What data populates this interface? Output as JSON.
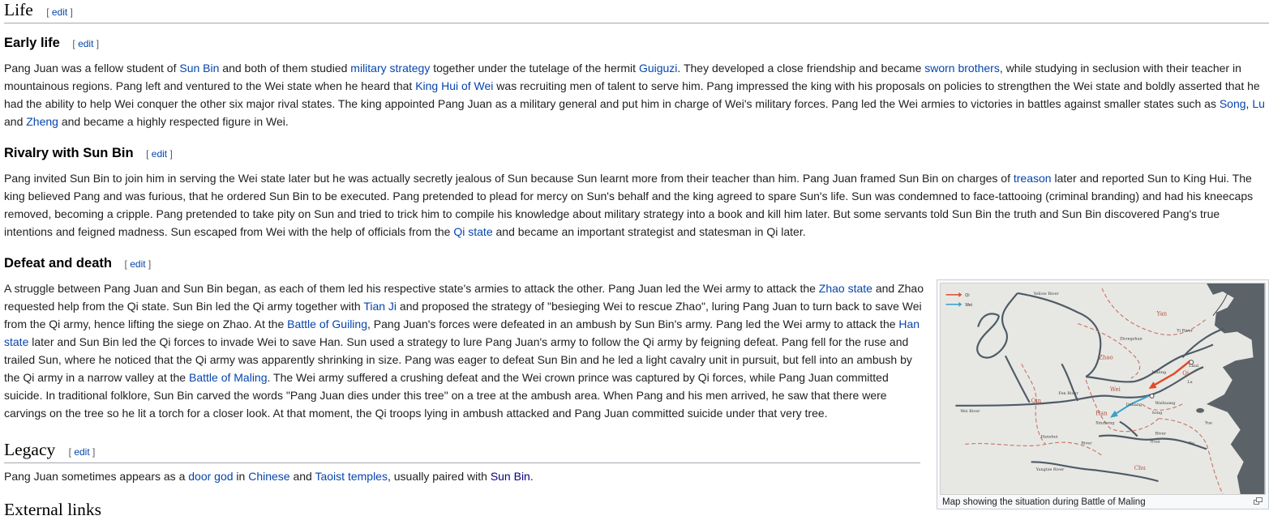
{
  "edit_label": "edit",
  "sections": {
    "life": {
      "title": "Life"
    },
    "early": {
      "title": "Early life",
      "text": [
        "Pang Juan was a fellow student of ",
        {
          "link": "Sun Bin"
        },
        " and both of them studied ",
        {
          "link": "military strategy"
        },
        " together under the tutelage of the hermit ",
        {
          "link": "Guiguzi"
        },
        ". They developed a close friendship and became ",
        {
          "link": "sworn brothers"
        },
        ", while studying in seclusion with their teacher in mountainous regions. Pang left and ventured to the Wei state when he heard that ",
        {
          "link": "King Hui of Wei"
        },
        " was recruiting men of talent to serve him. Pang impressed the king with his proposals on policies to strengthen the Wei state and boldly asserted that he had the ability to help Wei conquer the other six major rival states. The king appointed Pang Juan as a military general and put him in charge of Wei's military forces. Pang led the Wei armies to victories in battles against smaller states such as ",
        {
          "link": "Song"
        },
        ", ",
        {
          "link": "Lu"
        },
        " and ",
        {
          "link": "Zheng"
        },
        " and became a highly respected figure in Wei."
      ]
    },
    "rivalry": {
      "title": "Rivalry with Sun Bin",
      "text": [
        "Pang invited Sun Bin to join him in serving the Wei state later but he was actually secretly jealous of Sun because Sun learnt more from their teacher than him. Pang Juan framed Sun Bin on charges of ",
        {
          "link": "treason"
        },
        " later and reported Sun to King Hui. The king believed Pang and was furious, that he ordered Sun Bin to be executed. Pang pretended to plead for mercy on Sun's behalf and the king agreed to spare Sun's life. Sun was condemned to face-tattooing (criminal branding) and had his kneecaps removed, becoming a cripple. Pang pretended to take pity on Sun and tried to trick him to compile his knowledge about military strategy into a book and kill him later. But some servants told Sun Bin the truth and Sun Bin discovered Pang's true intentions and feigned madness. Sun escaped from Wei with the help of officials from the ",
        {
          "link": "Qi state"
        },
        " and became an important strategist and statesman in Qi later."
      ]
    },
    "defeat": {
      "title": "Defeat and death",
      "text": [
        "A struggle between Pang Juan and Sun Bin began, as each of them led his respective state's armies to attack the other. Pang Juan led the Wei army to attack the ",
        {
          "link": "Zhao state"
        },
        " and Zhao requested help from the Qi state. Sun Bin led the Qi army together with ",
        {
          "link": "Tian Ji"
        },
        " and proposed the strategy of \"besieging Wei to rescue Zhao\", luring Pang Juan to turn back to save Wei from the Qi army, hence lifting the siege on Zhao. At the ",
        {
          "link": "Battle of Guiling"
        },
        ", Pang Juan's forces were defeated in an ambush by Sun Bin's army. Pang led the Wei army to attack the ",
        {
          "link": "Han state"
        },
        " later and Sun Bin led the Qi forces to invade Wei to save Han. Sun used a strategy to lure Pang Juan's army to follow the Qi army by feigning defeat. Pang fell for the ruse and trailed Sun, where he noticed that the Qi army was apparently shrinking in size. Pang was eager to defeat Sun Bin and he led a light cavalry unit in pursuit, but fell into an ambush by the Qi army in a narrow valley at the ",
        {
          "link": "Battle of Maling"
        },
        ". The Wei army suffered a crushing defeat and the Wei crown prince was captured by Qi forces, while Pang Juan committed suicide. In traditional folklore, Sun Bin carved the words \"Pang Juan dies under this tree\" on a tree at the ambush area. When Pang and his men arrived, he saw that there were carvings on the tree so he lit a torch for a closer look. At that moment, the Qi troops lying in ambush attacked and Pang Juan committed suicide under that very tree."
      ]
    },
    "legacy": {
      "title": "Legacy",
      "text": [
        "Pang Juan sometimes appears as a ",
        {
          "link": "door god"
        },
        " in ",
        {
          "link": "Chinese"
        },
        " and ",
        {
          "link": "Taoist temples"
        },
        ", usually paired with ",
        {
          "link": "Sun Bin",
          "visited": true
        },
        "."
      ]
    },
    "external": {
      "title": "External links"
    }
  },
  "figure": {
    "caption": "Map showing the situation during Battle of Maling",
    "legend": [
      "Qi",
      "Wei"
    ],
    "labels": [
      "Yellow River",
      "Yan",
      "Yi River",
      "Zhongshan",
      "Zhao",
      "Linzi",
      "Qi",
      "Maling",
      "Lu",
      "Wei",
      "Fen River",
      "Qin",
      "Wei River",
      "Daliang",
      "Waihuang",
      "Song",
      "Han",
      "Xinzheng",
      "Ru",
      "Huai",
      "River",
      "Yue",
      "Hanshui",
      "River",
      "Yangtze River",
      "Chu"
    ],
    "colors": {
      "qi_arrow": "#e04a2a",
      "wei_arrow": "#3aa0c8",
      "sea": "#5b6268",
      "land": "#e7e8e4",
      "border": "#c97a6e",
      "river": "#4f5b66"
    }
  }
}
